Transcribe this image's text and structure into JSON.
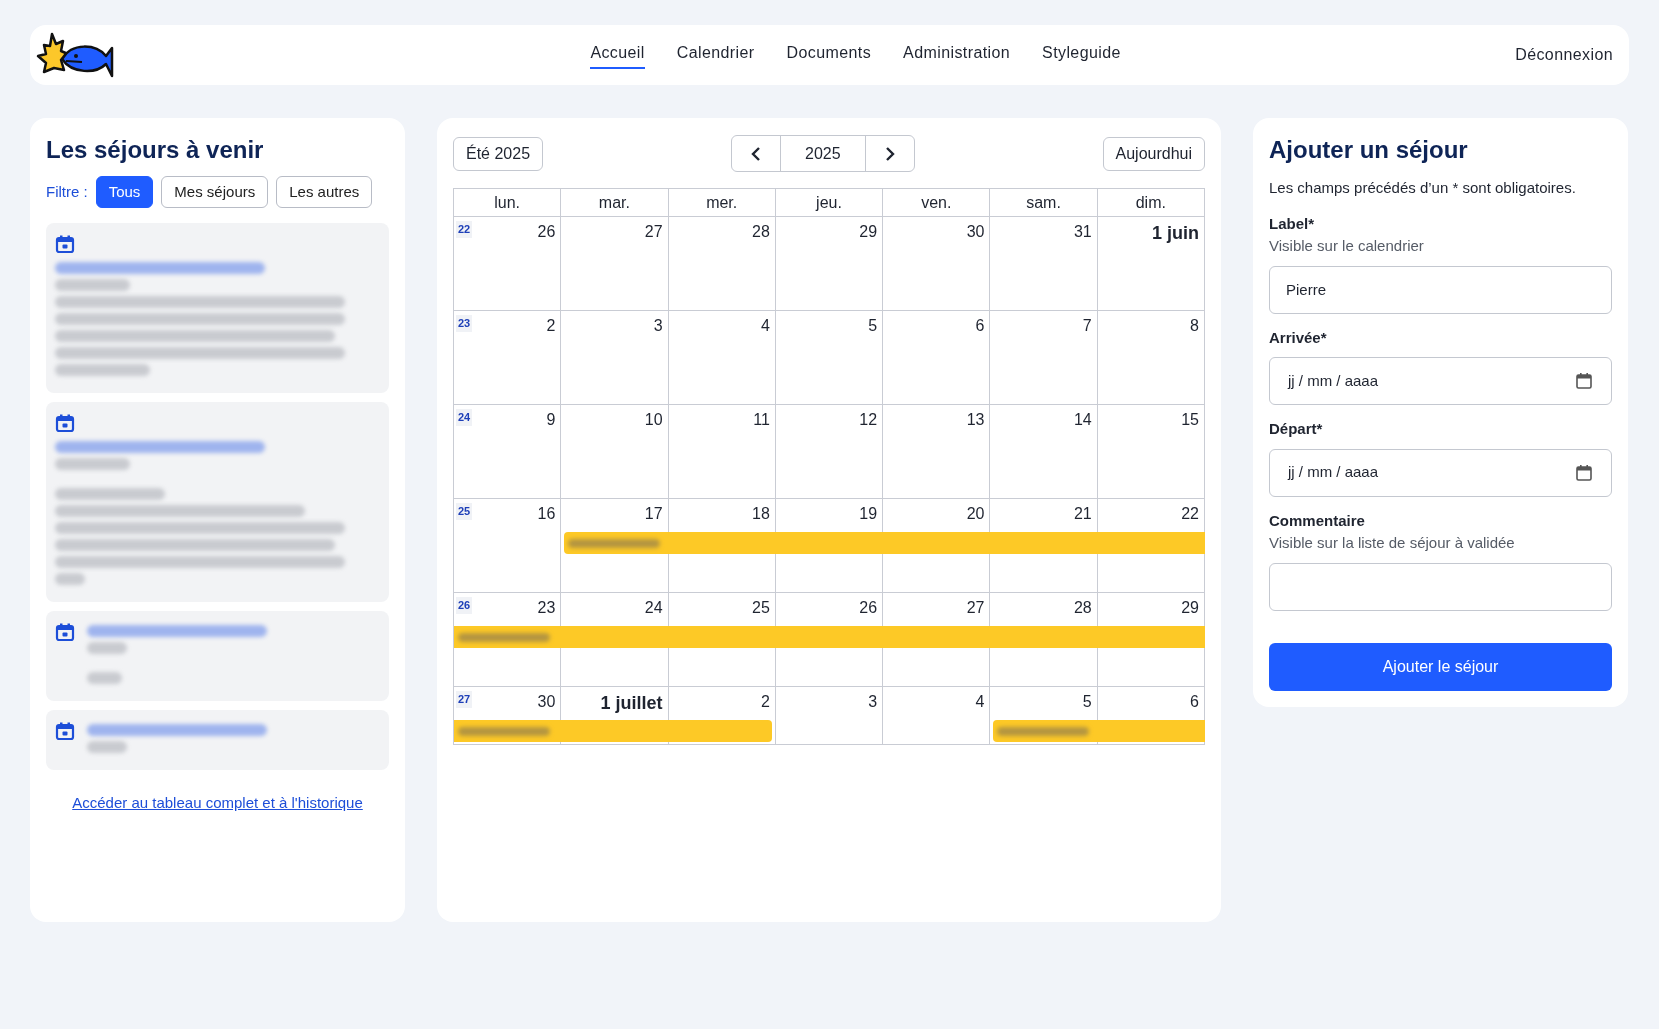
{
  "nav": {
    "items": [
      {
        "label": "Accueil",
        "selected": true
      },
      {
        "label": "Calendrier",
        "selected": false
      },
      {
        "label": "Documents",
        "selected": false
      },
      {
        "label": "Administration",
        "selected": false
      },
      {
        "label": "Styleguide",
        "selected": false
      }
    ],
    "logout": "Déconnexion"
  },
  "upcoming": {
    "title": "Les séjours à venir",
    "filter_label": "Filtre :",
    "filters": [
      {
        "label": "Tous",
        "selected": true
      },
      {
        "label": "Mes séjours",
        "selected": false
      },
      {
        "label": "Les autres",
        "selected": false
      }
    ],
    "history_link": "Accéder au tableau complet et à l'historique"
  },
  "calendar": {
    "season_button": "Été 2025",
    "year": "2025",
    "today_button": "Aujourdhui",
    "weekdays": [
      "lun.",
      "mar.",
      "mer.",
      "jeu.",
      "ven.",
      "sam.",
      "dim."
    ],
    "weeks": [
      {
        "number": "22",
        "days": [
          {
            "label": "26",
            "month_start": false,
            "booked": false
          },
          {
            "label": "27",
            "month_start": false,
            "booked": false
          },
          {
            "label": "28",
            "month_start": false,
            "booked": false
          },
          {
            "label": "29",
            "month_start": false,
            "booked": false
          },
          {
            "label": "30",
            "month_start": false,
            "booked": false
          },
          {
            "label": "31",
            "month_start": false,
            "booked": false
          },
          {
            "label": "1 juin",
            "month_start": true,
            "booked": false
          }
        ]
      },
      {
        "number": "23",
        "days": [
          {
            "label": "2",
            "month_start": false,
            "booked": false
          },
          {
            "label": "3",
            "month_start": false,
            "booked": false
          },
          {
            "label": "4",
            "month_start": false,
            "booked": false
          },
          {
            "label": "5",
            "month_start": false,
            "booked": false
          },
          {
            "label": "6",
            "month_start": false,
            "booked": false
          },
          {
            "label": "7",
            "month_start": false,
            "booked": false
          },
          {
            "label": "8",
            "month_start": false,
            "booked": false
          }
        ]
      },
      {
        "number": "24",
        "days": [
          {
            "label": "9",
            "month_start": false,
            "booked": false
          },
          {
            "label": "10",
            "month_start": false,
            "booked": false
          },
          {
            "label": "11",
            "month_start": false,
            "booked": false
          },
          {
            "label": "12",
            "month_start": false,
            "booked": false
          },
          {
            "label": "13",
            "month_start": false,
            "booked": false
          },
          {
            "label": "14",
            "month_start": false,
            "booked": false
          },
          {
            "label": "15",
            "month_start": false,
            "booked": false
          }
        ]
      },
      {
        "number": "25",
        "days": [
          {
            "label": "16",
            "month_start": false,
            "booked": false
          },
          {
            "label": "17",
            "month_start": false,
            "booked": true
          },
          {
            "label": "18",
            "month_start": false,
            "booked": true
          },
          {
            "label": "19",
            "month_start": false,
            "booked": true
          },
          {
            "label": "20",
            "month_start": false,
            "booked": true
          },
          {
            "label": "21",
            "month_start": false,
            "booked": true
          },
          {
            "label": "22",
            "month_start": false,
            "booked": true
          }
        ]
      },
      {
        "number": "26",
        "days": [
          {
            "label": "23",
            "month_start": false,
            "booked": true
          },
          {
            "label": "24",
            "month_start": false,
            "booked": true
          },
          {
            "label": "25",
            "month_start": false,
            "booked": true
          },
          {
            "label": "26",
            "month_start": false,
            "booked": true
          },
          {
            "label": "27",
            "month_start": false,
            "booked": true
          },
          {
            "label": "28",
            "month_start": false,
            "booked": true
          },
          {
            "label": "29",
            "month_start": false,
            "booked": true
          }
        ]
      },
      {
        "number": "27",
        "days": [
          {
            "label": "30",
            "month_start": false,
            "booked": true
          },
          {
            "label": "1 juillet",
            "month_start": true,
            "booked": true
          },
          {
            "label": "2",
            "month_start": false,
            "booked": true
          },
          {
            "label": "3",
            "month_start": false,
            "booked": false
          },
          {
            "label": "4",
            "month_start": false,
            "booked": false
          },
          {
            "label": "5",
            "month_start": false,
            "booked": true
          },
          {
            "label": "6",
            "month_start": false,
            "booked": true
          }
        ]
      }
    ]
  },
  "form": {
    "title": "Ajouter un séjour",
    "note": "Les champs précédés d’un * sont obligatoires.",
    "fields": [
      {
        "kind": "text",
        "label": "Label*",
        "hint": "Visible sur le calendrier",
        "value": "Pierre"
      },
      {
        "kind": "date",
        "label": "Arrivée*",
        "value": "jj / mm / aaaa"
      },
      {
        "kind": "date",
        "label": "Départ*",
        "value": "jj / mm / aaaa"
      },
      {
        "kind": "text",
        "label": "Commentaire",
        "hint": "Visible sur la liste de séjour à validée"
      }
    ],
    "submit": "Ajouter le séjour"
  }
}
